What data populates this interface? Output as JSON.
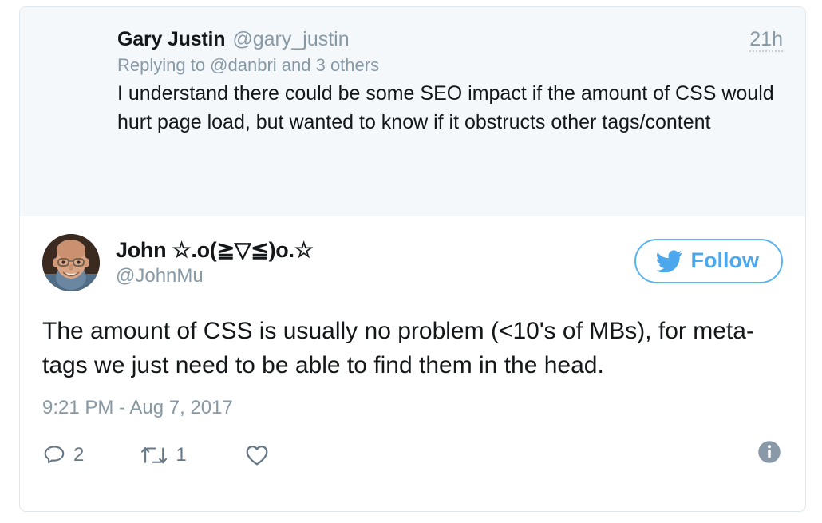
{
  "parent_tweet": {
    "full_name": "Gary Justin",
    "handle": "@gary_justin",
    "timestamp": "21h",
    "replying_to": "Replying to @danbri and 3 others",
    "body": "I understand there could be some SEO impact if the amount of CSS would hurt page load, but wanted to know if it obstructs other tags/content"
  },
  "main_tweet": {
    "author_name": "John ☆.o(≧▽≦)o.☆",
    "author_handle": "@JohnMu",
    "follow_label": "Follow",
    "body": "The amount of CSS is usually no problem (<10's of MBs), for meta-tags we just need to be able to find them in the head.",
    "timestamp": "9:21 PM - Aug 7, 2017",
    "actions": {
      "reply_count": "2",
      "retweet_count": "1",
      "like_count": ""
    }
  },
  "icons": {
    "avatar": "avatar-photo",
    "bird": "twitter-bird-icon",
    "reply": "reply-icon",
    "retweet": "retweet-icon",
    "like": "heart-icon",
    "info": "info-icon"
  },
  "colors": {
    "brand_blue": "#4da7ec",
    "muted_gray": "#8899a6",
    "action_gray": "#667786",
    "text_dark": "#14171a",
    "parent_bg": "#f4f8fa",
    "card_border": "#e1e8ed"
  }
}
